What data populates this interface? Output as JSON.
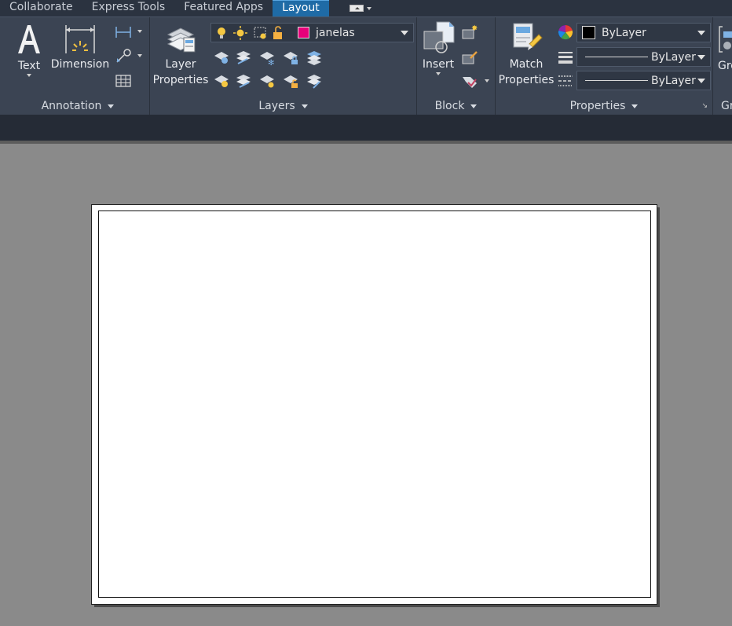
{
  "tabs": [
    {
      "label": "Collaborate",
      "active": false
    },
    {
      "label": "Express Tools",
      "active": false
    },
    {
      "label": "Featured Apps",
      "active": false
    },
    {
      "label": "Layout",
      "active": true
    }
  ],
  "annotation": {
    "title": "Annotation",
    "text_label": "Text",
    "dimension_label": "Dimension"
  },
  "layers": {
    "title": "Layers",
    "properties_label_1": "Layer",
    "properties_label_2": "Properties",
    "current_layer": "janelas",
    "current_layer_color": "#e8007a"
  },
  "block": {
    "title": "Block",
    "insert_label": "Insert"
  },
  "properties": {
    "title": "Properties",
    "match_label_1": "Match",
    "match_label_2": "Properties",
    "color_value": "ByLayer",
    "linetype_value": "ByLayer",
    "lineweight_value": "ByLayer"
  },
  "groups": {
    "label_top": "Gro",
    "label_bottom": "Gr"
  },
  "colors": {
    "ribbon_bg": "#3b4453",
    "tab_active": "#1f6ba6",
    "canvas_bg": "#8a8a8a"
  }
}
